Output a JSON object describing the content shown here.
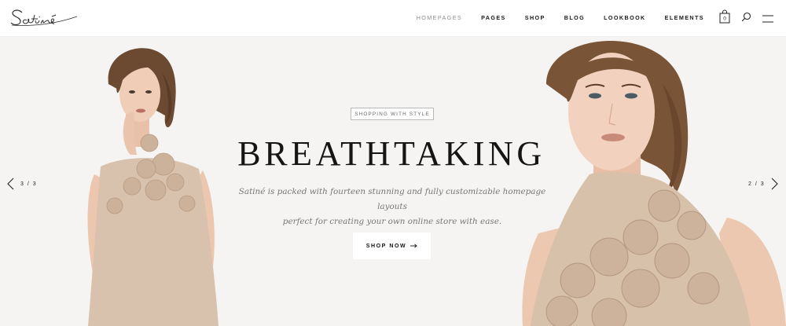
{
  "header": {
    "logo_text": "Satiné",
    "nav": [
      {
        "label": "HOMEPAGES",
        "active": true
      },
      {
        "label": "PAGES",
        "active": false
      },
      {
        "label": "SHOP",
        "active": false
      },
      {
        "label": "BLOG",
        "active": false
      },
      {
        "label": "LOOKBOOK",
        "active": false
      },
      {
        "label": "ELEMENTS",
        "active": false
      }
    ],
    "cart_count": "0",
    "icons": [
      "shopping-bag-icon",
      "search-icon",
      "hamburger-menu-icon"
    ]
  },
  "slider": {
    "eyebrow": "SHOPPING WITH STYLE",
    "headline": "BREATHTAKING",
    "subtext_line1": "Satiné is packed with fourteen stunning and fully customizable homepage layouts",
    "subtext_line2": "perfect for creating your own online store with ease.",
    "button_label": "SHOP NOW",
    "prev_counter": "3 / 3",
    "next_counter": "2 / 3"
  },
  "colors": {
    "header_bg": "#ffffff",
    "slider_bg": "#f5f4f2",
    "dress": "#d9c2ad",
    "text_dark": "#151515",
    "text_muted": "#777777"
  }
}
